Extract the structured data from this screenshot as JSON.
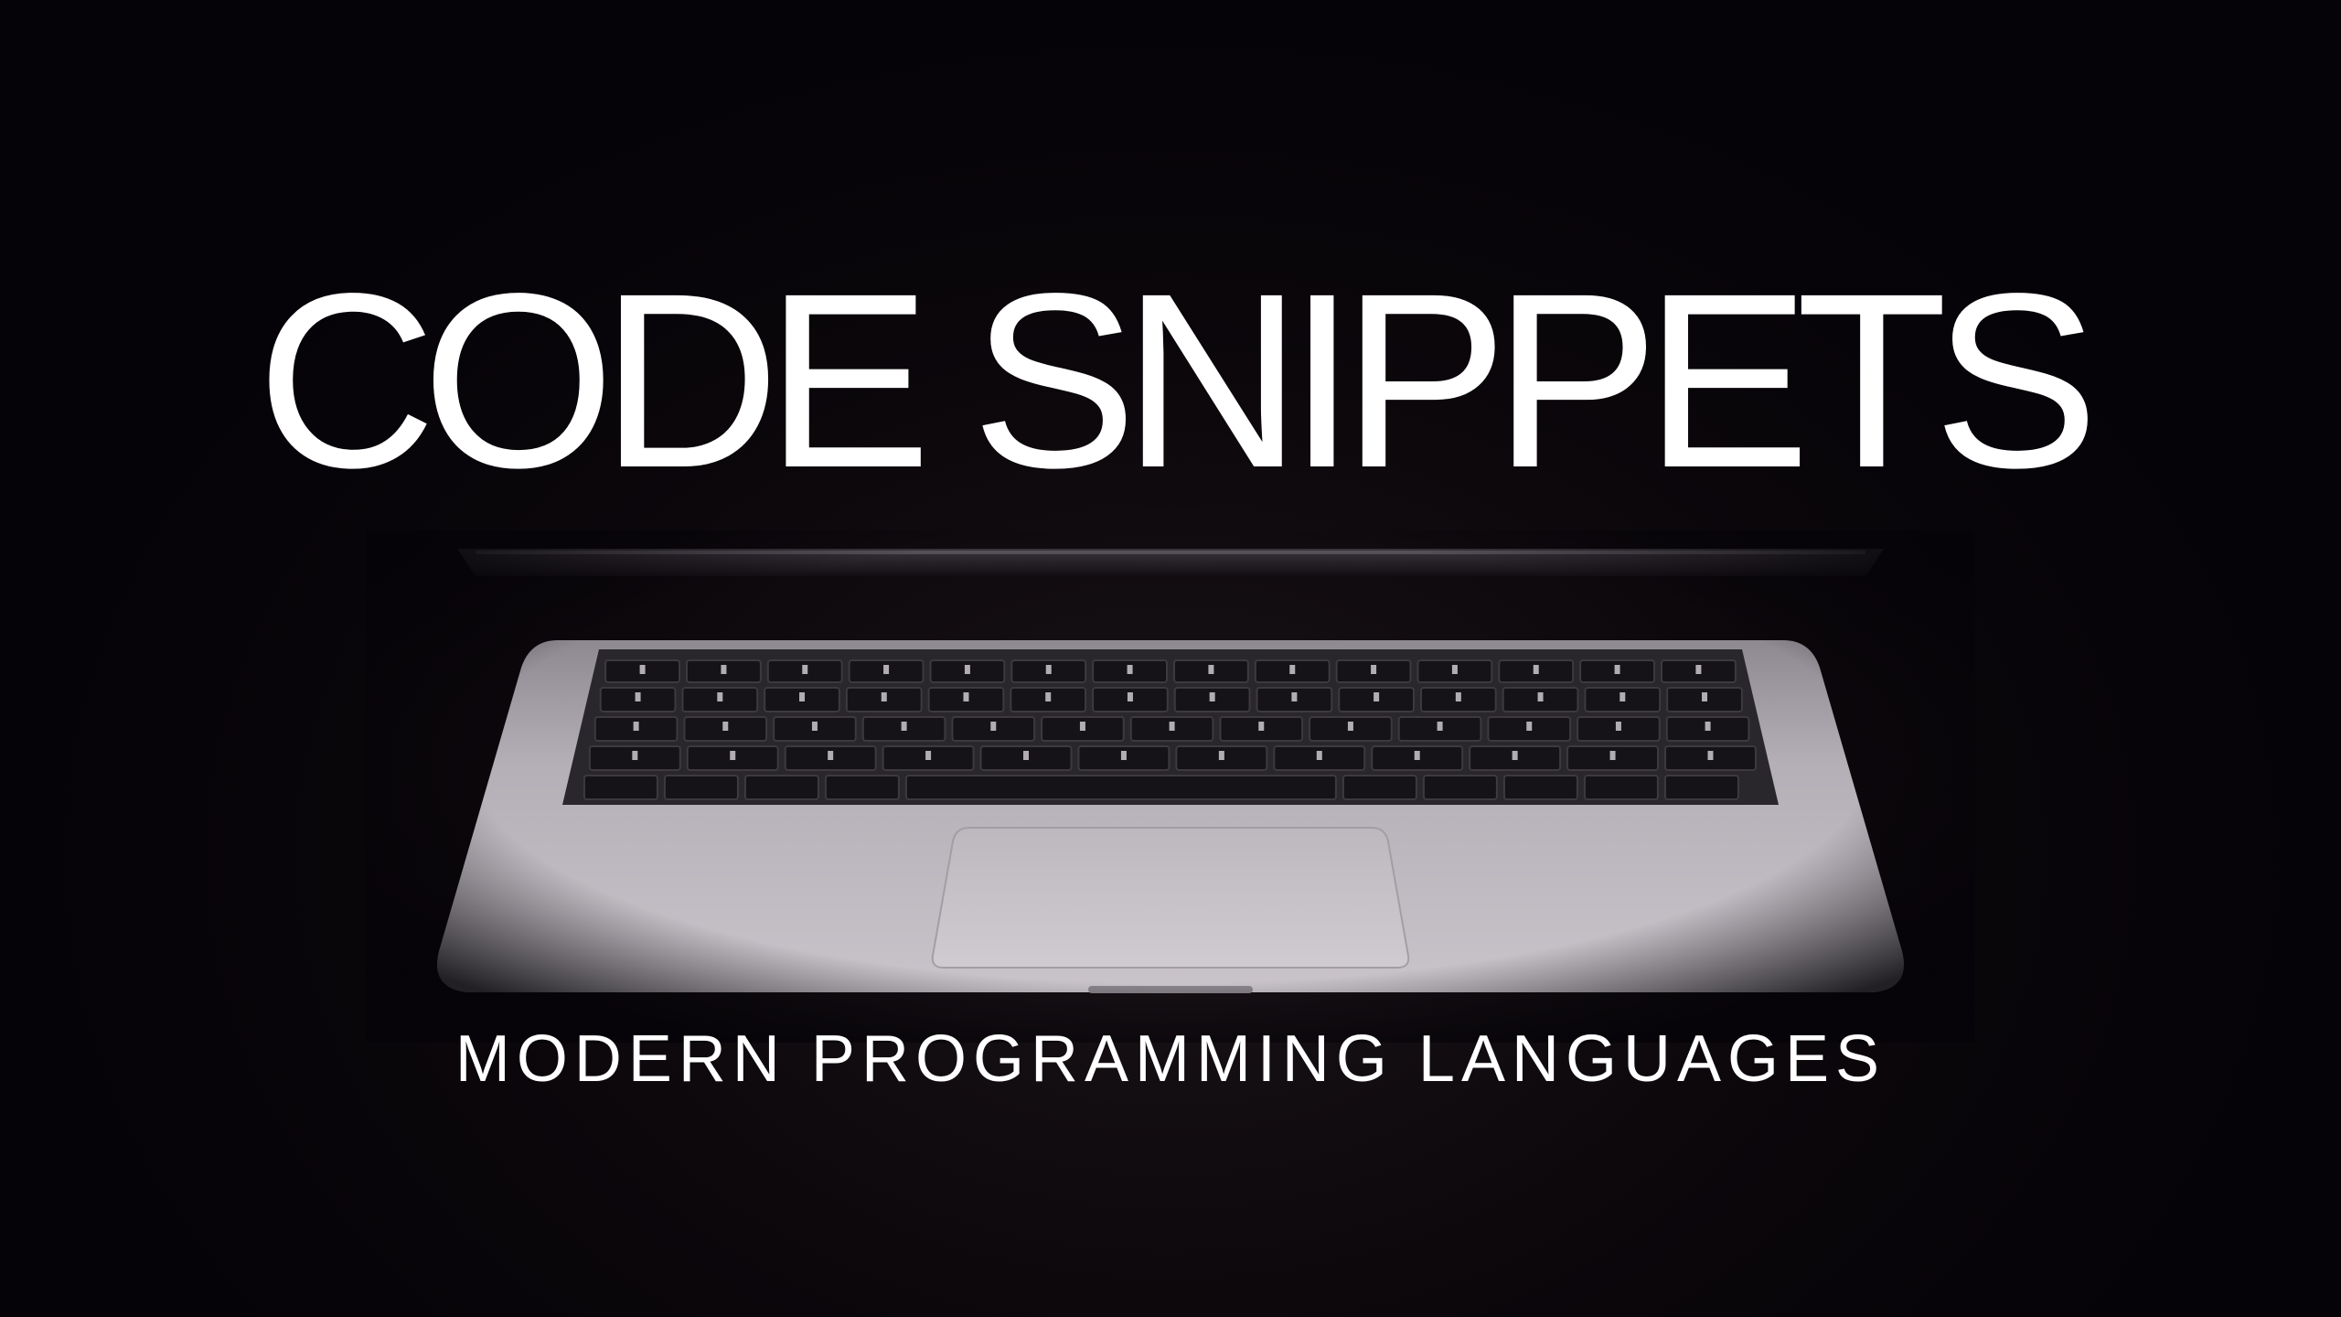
{
  "title": "CODE SNIPPETS",
  "subtitle": "MODERN PROGRAMMING LANGUAGES",
  "colors": {
    "background": "#050308",
    "text": "#ffffff",
    "laptop_body": "#b9b4ba",
    "keys": "#1a1a1e"
  },
  "icons": [
    "laptop-keyboard-illustration"
  ]
}
